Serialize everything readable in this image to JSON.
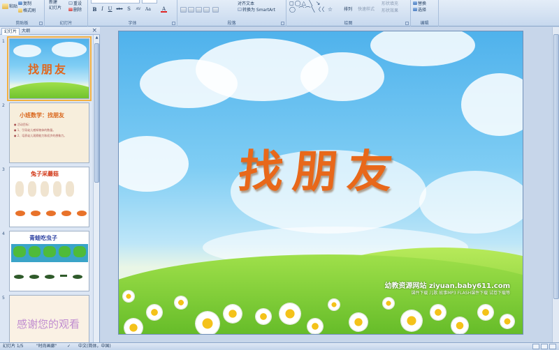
{
  "ribbon": {
    "clipboard": {
      "paste": "粘贴",
      "copy": "复制",
      "format_painter": "格式刷",
      "label": "剪贴板"
    },
    "slides": {
      "new_slide": "新建",
      "new_slide_sub": "幻灯片",
      "layout": "版式",
      "reset": "重设",
      "delete": "删除",
      "label": "幻灯片"
    },
    "font": {
      "bold": "B",
      "italic": "I",
      "underline": "U",
      "strike": "abe",
      "shadow": "S",
      "spacing": "AV",
      "case": "Aa",
      "color": "A",
      "label": "字体"
    },
    "paragraph": {
      "align_text": "对齐文本",
      "smartart": "转换为 SmartArt",
      "label": "段落"
    },
    "drawing": {
      "arrange": "排列",
      "quick_styles": "快速样式",
      "shape_fill": "形状填充",
      "shape_effects": "形状效果",
      "label": "绘图"
    },
    "editing": {
      "find": "查找",
      "replace": "替换",
      "select": "选择",
      "label": "编辑"
    }
  },
  "panel": {
    "tab_slides": "幻灯片",
    "tab_outline": "大纲",
    "close": "×"
  },
  "thumbnails": [
    {
      "num": "1",
      "title": "找朋友"
    },
    {
      "num": "2",
      "title": "小班数学：找朋友",
      "lines": [
        "● 活动目标：",
        "● 1、引导幼儿感知物体的数量。",
        "● 2、培养幼儿观察能力和初步的想象力。"
      ]
    },
    {
      "num": "3",
      "title": "兔子采蘑菇"
    },
    {
      "num": "4",
      "title": "青蛙吃虫子"
    },
    {
      "num": "5",
      "title": "感谢您的观看"
    }
  ],
  "slide": {
    "title": "找朋友",
    "watermark": "幼教资源网站  ziyuan.baby611.com",
    "watermark_sub": "课件下载  儿歌  故事MP3  FLASH课件下载  试卷下载等"
  },
  "status": {
    "slide_count": "幻灯片 1/5",
    "theme": "\"时尚画廊\"",
    "language": "中文(简体，中国)"
  },
  "colors": {
    "title_orange": "#e8681a",
    "sky_blue": "#4fb2ec",
    "grass_green": "#4fae1c",
    "ribbon_bg": "#d3e1f2"
  }
}
